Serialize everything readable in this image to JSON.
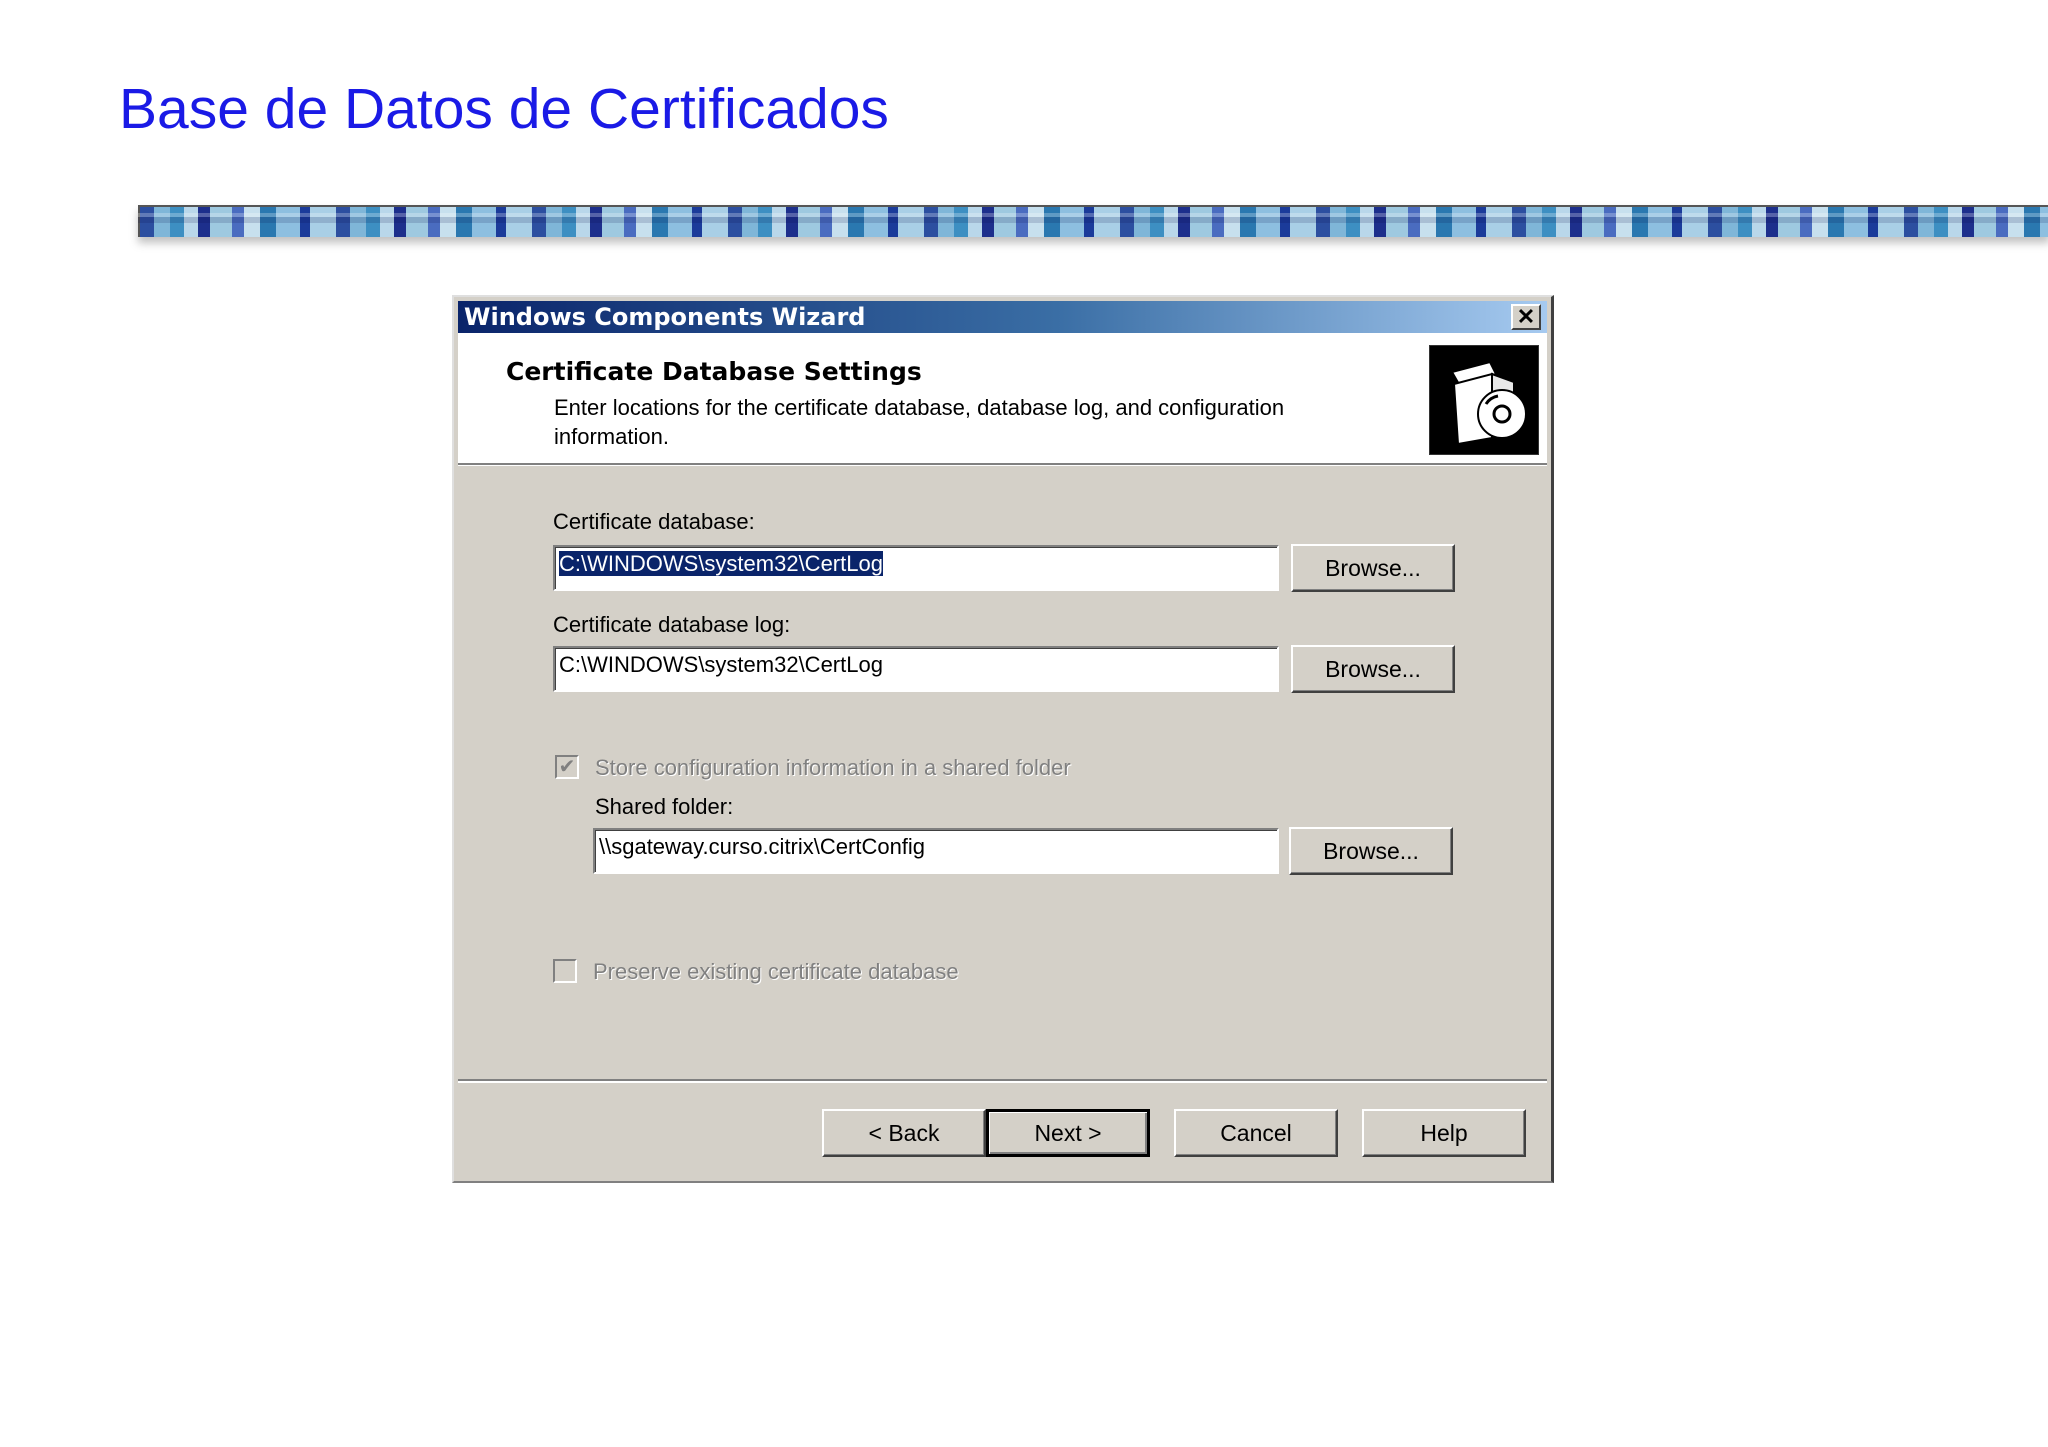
{
  "slide": {
    "title": "Base de Datos de Certificados"
  },
  "dialog": {
    "title": "Windows Components Wizard",
    "close_glyph": "✕",
    "header": {
      "title": "Certificate Database Settings",
      "description": "Enter locations for the certificate database, database log, and configuration information."
    },
    "cert_db": {
      "label": "Certificate database:",
      "value": "C:\\WINDOWS\\system32\\CertLog",
      "browse": "Browse..."
    },
    "cert_db_log": {
      "label": "Certificate database log:",
      "value": "C:\\WINDOWS\\system32\\CertLog",
      "browse": "Browse..."
    },
    "shared": {
      "checkbox_label": "Store configuration information in a shared folder",
      "checked": true,
      "folder_label": "Shared folder:",
      "folder_value": "\\\\sgateway.curso.citrix\\CertConfig",
      "browse": "Browse..."
    },
    "preserve": {
      "checkbox_label": "Preserve existing certificate database",
      "checked": false
    },
    "buttons": {
      "back": "< Back",
      "next": "Next >",
      "cancel": "Cancel",
      "help": "Help"
    }
  },
  "colors": {
    "title_blue": "#1a1ae6",
    "dialog_face": "#d4d0c8",
    "titlebar_start": "#0a246a",
    "titlebar_end": "#a6caf0"
  }
}
